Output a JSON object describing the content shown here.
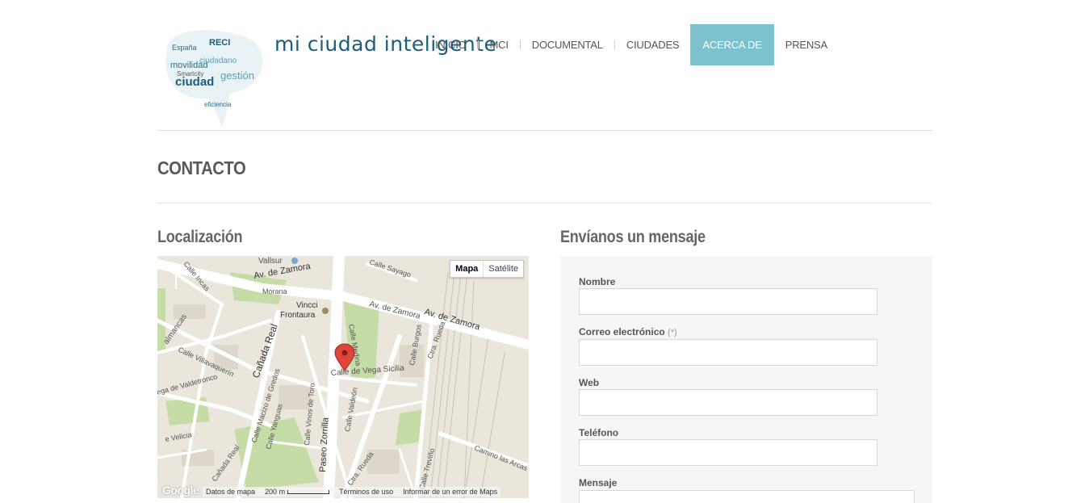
{
  "site": {
    "title": "mi ciudad inteligente"
  },
  "logo": {
    "words": [
      "España",
      "RECI",
      "ciudad",
      "gestión",
      "movilidad",
      "ciudadano",
      "Smartcity",
      "eficiencia"
    ]
  },
  "nav": {
    "items": [
      "INICIO",
      "MCI",
      "DOCUMENTAL",
      "CIUDADES",
      "ACERCA DE",
      "PRENSA"
    ],
    "active": "ACERCA DE"
  },
  "page": {
    "title": "CONTACTO"
  },
  "location": {
    "title": "Localización"
  },
  "map": {
    "toggle": {
      "map": "Mapa",
      "satellite": "Satélite"
    },
    "labels": {
      "vallsur": "Vallsur",
      "zamora1": "Av. de Zamora",
      "zamora2": "Av. de Zamora",
      "zamora3": "Av. de Zamora",
      "sayago": "Calle Sayago",
      "incas": "Calle Incas",
      "morana": "Morana",
      "vincci": "Vincci",
      "frontaura": "Frontaura",
      "salamancas": "almancas",
      "canada": "Cañada Real",
      "villavaquerin": "Calle Villavaquerín",
      "valdetronco": "ega de Valdetronco",
      "velicia": "e Velicia",
      "gredos": "Calle Macizo de Gredos",
      "toro": "Calle Vinos de Toro",
      "yanguas": "Calle Yanguas",
      "zorrilla": "Paseo Zorrilla",
      "valdeon": "Calle Valdeón",
      "vegasicilia": "Calle de Vega Sicilia",
      "medina": "Calle Medina",
      "burgos": "Calle Burgos",
      "rueda1": "Ctra. Rueda",
      "rueda2": "Ctra. Rueda",
      "canada2": "Cañada Real",
      "trevino": "Calle Treviño",
      "arcas": "Camino las Arcas"
    },
    "footer": {
      "brand": "Google",
      "data": "Datos de mapa",
      "scale": "200 m",
      "terms": "Términos de uso",
      "report": "Informar de un error de Maps"
    }
  },
  "form": {
    "title": "Envíanos un mensaje",
    "fields": [
      {
        "label": "Nombre",
        "required_mark": ""
      },
      {
        "label": "Correo electrónico",
        "required_mark": "(*)"
      },
      {
        "label": "Web",
        "required_mark": ""
      },
      {
        "label": "Teléfono",
        "required_mark": ""
      },
      {
        "label": "Mensaje",
        "required_mark": ""
      }
    ]
  },
  "colors": {
    "accent": "#7cc1cc",
    "brand": "#1b5e7a",
    "map_bg": "#ebe6dc",
    "park": "#c6dca6",
    "marker": "#e0453a"
  }
}
